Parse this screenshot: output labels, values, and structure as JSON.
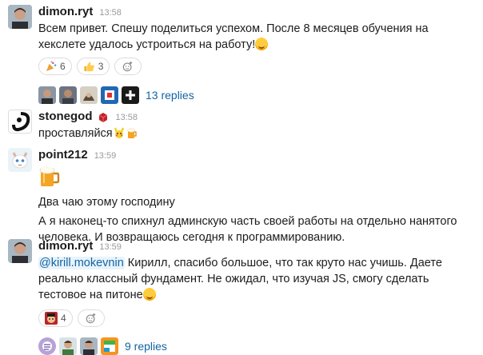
{
  "messages": [
    {
      "author": "dimon.ryt",
      "time": "13:58",
      "text": "Всем привет. Спешу поделиться успехом. После 8 месяцев обучения на хекслете удалось устроиться на работу!",
      "reactions": [
        {
          "icon": "party-popper-icon",
          "count": "6"
        },
        {
          "icon": "thumbs-up-icon",
          "count": "3"
        }
      ],
      "thread": {
        "replies": "13 replies"
      }
    },
    {
      "author": "stonegod",
      "time": "13:58",
      "text": "проставляйся"
    },
    {
      "author": "point212",
      "time": "13:59",
      "lines": [
        "Два чаю этому господину",
        "А я наконец-то спихнул админскую часть своей работы на отдельно нанятого человека. И возвращаюсь сегодня к программированию."
      ]
    },
    {
      "author": "dimon.ryt",
      "time": "13:59",
      "mention": "@kirill.mokevnin",
      "text": " Кирилл, спасибо большое, что так круто нас учишь. Даете реально классный фундамент. Не ожидал, что изучая JS, смогу сделать тестовое на питоне",
      "reactions": [
        {
          "icon": "custom-face-icon",
          "count": "4"
        }
      ],
      "thread": {
        "replies": "9 replies"
      }
    }
  ],
  "colors": {
    "link": "#1264a3",
    "muted": "#9a9a9a"
  }
}
